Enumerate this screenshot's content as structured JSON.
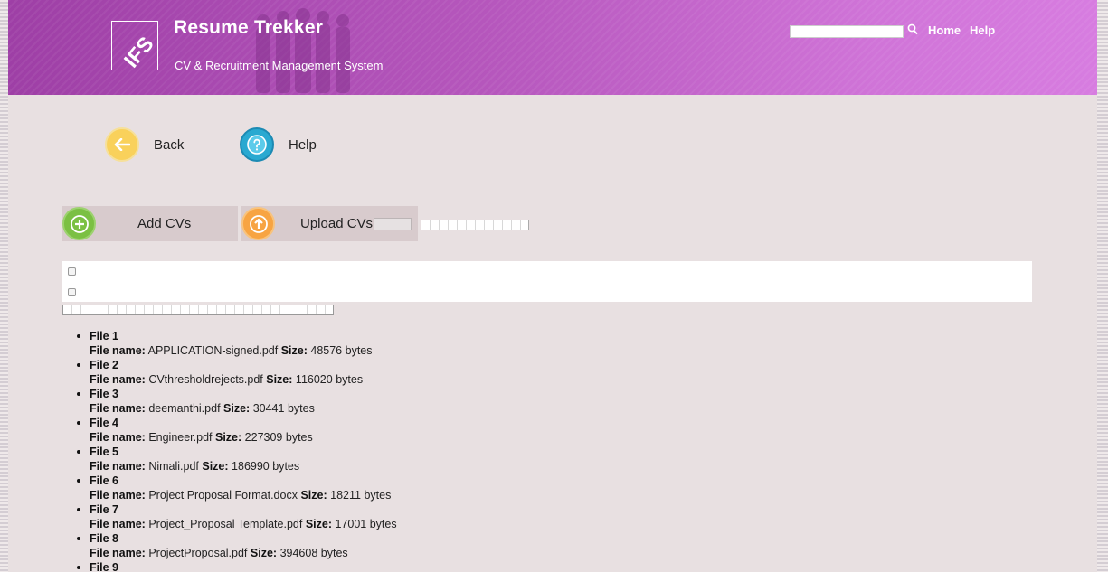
{
  "header": {
    "logo_text": "IFS",
    "title": "Resume Trekker",
    "subtitle": "CV & Recruitment Management System",
    "search": {
      "value": "",
      "placeholder": ""
    },
    "nav": {
      "home": "Home",
      "help": "Help"
    }
  },
  "toolbar": {
    "back_label": "Back",
    "help_label": "Help"
  },
  "actions": {
    "add_label": "Add CVs",
    "upload_label": "Upload CVs"
  },
  "labels": {
    "file_name": "File name:",
    "size": "Size:",
    "bytes": "bytes"
  },
  "files": [
    {
      "title": "File 1",
      "name": "APPLICATION-signed.pdf",
      "size": "48576"
    },
    {
      "title": "File 2",
      "name": "CVthresholdrejects.pdf",
      "size": "116020"
    },
    {
      "title": "File 3",
      "name": "deemanthi.pdf",
      "size": "30441"
    },
    {
      "title": "File 4",
      "name": "Engineer.pdf",
      "size": "227309"
    },
    {
      "title": "File 5",
      "name": "Nimali.pdf",
      "size": "186990"
    },
    {
      "title": "File 6",
      "name": "Project Proposal Format.docx",
      "size": "18211"
    },
    {
      "title": "File 7",
      "name": "Project_Proposal Template.pdf",
      "size": "17001"
    },
    {
      "title": "File 8",
      "name": "ProjectProposal.pdf",
      "size": "394608"
    },
    {
      "title": "File 9",
      "name": "",
      "size": ""
    }
  ],
  "colors": {
    "header_start": "#9e3fa6",
    "header_end": "#d77ce0",
    "back_yellow": "#f9d15b",
    "help_blue": "#29a9d1",
    "add_green": "#7bc043",
    "upload_orange": "#f7a442",
    "page_bg": "#e8e0e1"
  },
  "icons": {
    "search": "search-icon",
    "back": "arrow-left-icon",
    "help": "question-icon",
    "add": "plus-circle-icon",
    "upload": "arrow-up-icon"
  }
}
